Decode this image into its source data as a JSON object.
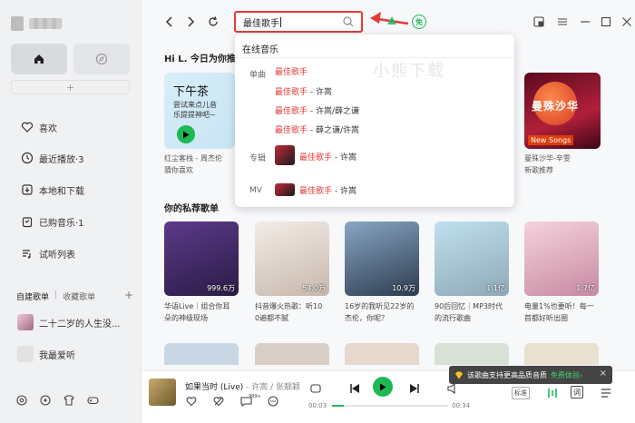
{
  "sidebar": {
    "items": [
      {
        "label": "喜欢",
        "icon": "heart-icon"
      },
      {
        "label": "最近播放·3",
        "icon": "clock-icon"
      },
      {
        "label": "本地和下载",
        "icon": "download-icon"
      },
      {
        "label": "已购音乐·1",
        "icon": "bag-icon"
      },
      {
        "label": "试听列表",
        "icon": "list-icon"
      }
    ],
    "section_created": "自建歌单",
    "section_collected": "收藏歌单",
    "add_symbol": "+",
    "playlists": [
      {
        "label": "二十二岁的人生没..."
      },
      {
        "label": "我最爱听"
      }
    ]
  },
  "search": {
    "value": "最佳歌手"
  },
  "topbar": {
    "free_badge": "免"
  },
  "main": {
    "greeting": "Hi L. 今日为你推",
    "daily": {
      "title": "下午茶",
      "subtitle_l1": "尝试来点儿音",
      "subtitle_l2": "乐提提神吧~",
      "caption_l1": "红尘客栈 - 周杰伦",
      "caption_l2": "猜你喜欢"
    },
    "right_card": {
      "title": "曼殊沙华",
      "badge": "New Songs",
      "caption_l1": "曼殊沙华-辛雯",
      "caption_l2": "新歌推荐"
    },
    "section_title": "你的私荐歌单",
    "playlists": [
      {
        "count": "999.6万",
        "caption_l1": "华语Live｜组合你耳",
        "caption_l2": "朵的神级现场"
      },
      {
        "count": "54.0万",
        "caption_l1": "抖音爆火热歌：听10",
        "caption_l2": "0遍都不腻"
      },
      {
        "count": "10.9万",
        "caption_l1": "16岁的我听见22岁的",
        "caption_l2": "杰伦，你呢？"
      },
      {
        "count": "1.1亿",
        "caption_l1": "90后回忆｜MP3时代",
        "caption_l2": "的流行歌曲"
      },
      {
        "count": "1.7亿",
        "caption_l1": "电量1%也要听！每一",
        "caption_l2": "首都好听出圈"
      }
    ]
  },
  "dropdown": {
    "header": "在线音乐",
    "watermark": "小熊下载",
    "category_single": "单曲",
    "category_album": "专辑",
    "category_mv": "MV",
    "singles": [
      {
        "highlight": "最佳歌手",
        "rest": ""
      },
      {
        "highlight": "最佳歌手",
        "rest": " - 许嵩"
      },
      {
        "highlight": "最佳歌手",
        "rest": " - 许嵩/薛之谦"
      },
      {
        "highlight": "最佳歌手",
        "rest": " - 薛之谦/许嵩"
      }
    ],
    "album": {
      "highlight": "最佳歌手",
      "rest": " - 许嵩"
    },
    "mv": {
      "highlight": "最佳歌手",
      "rest": " - 许嵩"
    }
  },
  "player": {
    "song_title": "如果当时 (Live)",
    "artist": " - 许嵩 / 张靓颖",
    "comment_count": "999+",
    "time_current": "00:03",
    "time_total": "00:34",
    "quality": "标准",
    "lyric_btn": "词"
  },
  "toast": {
    "text": "该歌曲支持更高品质音质",
    "link": "免费体验›",
    "close": "×"
  },
  "colors": {
    "accent": "#1db954",
    "highlight": "#e33a3a"
  }
}
